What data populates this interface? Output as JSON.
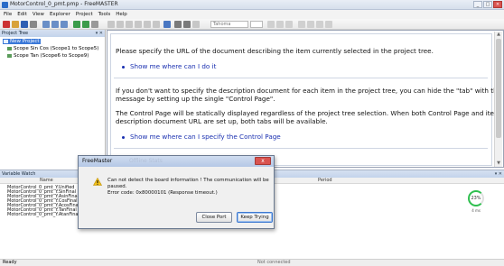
{
  "window": {
    "title": "MotorControl_0_pmt.pmp - FreeMASTER"
  },
  "menu": [
    "File",
    "Edit",
    "View",
    "Explorer",
    "Project",
    "Tools",
    "Help"
  ],
  "toolbar": {
    "font_combo": "Tahoma"
  },
  "project_tree": {
    "header": "Project Tree",
    "items": [
      {
        "label": "New Project",
        "selected": true
      },
      {
        "label": "Scope Sin Cos (Scope1 to Scope5)",
        "selected": false
      },
      {
        "label": "Scope Tan (Scope6 to Scope9)",
        "selected": false
      }
    ]
  },
  "main": {
    "para1": "Please specify the URL of the document describing the item currently selected in the project tree.",
    "link1": "Show me where can I do it",
    "para2_line1": "If you don't want to specify the description document for each item in the project tree, you can hide the \"tab\" with this",
    "para2_line2": "message by setting up the single \"Control Page\".",
    "para3_line1": "The Control Page will be statically displayed regardless of the project tree selection. When both Control Page and item",
    "para3_line2": "description document URL are set up, both tabs will be available.",
    "link2": "Show me where can I specify the Control Page"
  },
  "watch": {
    "header": "Variable Watch",
    "columns": {
      "name": "Name",
      "period": "Period"
    },
    "rows": [
      "MotorControl_0_pmt_Y.Unified",
      "MotorControl_0_pmt_Y.SinFinal",
      "MotorControl_0_pmt_Y.AsinFinal",
      "MotorControl_0_pmt_Y.CosFinal",
      "MotorControl_0_pmt_Y.AcosFinal",
      "MotorControl_0_pmt_Y.TanFinal",
      "MotorControl_0_pmt_Y.AtanFinal"
    ],
    "gauge": {
      "value": "23%",
      "unit": "4 ms"
    }
  },
  "statusbar": {
    "left": "Ready",
    "center": "Not connected"
  },
  "dialog": {
    "title": "FreeMaster",
    "ghost_title": "Offline Stats",
    "message_line1": "Can not detect the board information ! The communication will be",
    "message_line2": "paused.",
    "message_line3": "Error code: 0x80000101 (Response timeout.)",
    "close_port": "Close Port",
    "keep_trying": "Keep Trying",
    "close_glyph": "x"
  },
  "colors": {
    "link": "#1a30b0",
    "selection": "#3a78d8",
    "close_red": "#d9534f"
  }
}
